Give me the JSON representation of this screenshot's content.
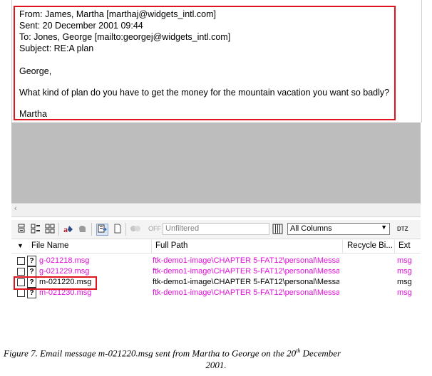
{
  "email": {
    "from": "From: James, Martha [marthaj@widgets_intl.com]",
    "sent": "Sent: 20 December 2001 09:44",
    "to": "To: Jones, George [mailto:georgej@widgets_intl.com]",
    "subject": "Subject: RE:A plan",
    "greeting": "George,",
    "body": "What kind of plan do you have to get the money for the mountain vacation you want so badly?",
    "signature": "Martha"
  },
  "scrollbar": {
    "left_arrow": "‹"
  },
  "toolbar": {
    "off_label": "OFF",
    "filter_value": "Unfiltered",
    "columns_value": "All Columns",
    "dtz_label": "DTZ",
    "icons": [
      "grid-icon",
      "list-icon",
      "tiles-icon",
      "bookmark-icon",
      "hand-icon",
      "export-icon",
      "page-icon",
      "filter-toggle-icon",
      "columns-icon"
    ]
  },
  "table": {
    "columns": [
      "File Name",
      "Full Path",
      "Recycle Bi...",
      "Ext"
    ],
    "rows": [
      {
        "name": "g-021218.msg",
        "path": "ftk-demo1-image\\CHAPTER 5-FAT12\\personal\\Messa...",
        "ext": "msg",
        "color": "#e010d8"
      },
      {
        "name": "g-021229.msg",
        "path": "ftk-demo1-image\\CHAPTER 5-FAT12\\personal\\Messa...",
        "ext": "msg",
        "color": "#e010d8"
      },
      {
        "name": "m-021220.msg",
        "path": "ftk-demo1-image\\CHAPTER 5-FAT12\\personal\\Messa...",
        "ext": "msg",
        "color": "#000000"
      },
      {
        "name": "m-021230.msg",
        "path": "ftk-demo1-image\\CHAPTER 5-FAT12\\personal\\Messa...",
        "ext": "msg",
        "color": "#e010d8"
      }
    ]
  },
  "caption": {
    "line1_prefix": "Figure 7.     Email message m-021220.msg sent from Martha to George on the 20",
    "sup": "th",
    "line1_suffix": " December",
    "line2": "2001."
  },
  "colors": {
    "highlight": "#e0141e",
    "magenta": "#e010d8",
    "grey_pane": "#bdbdbd"
  }
}
